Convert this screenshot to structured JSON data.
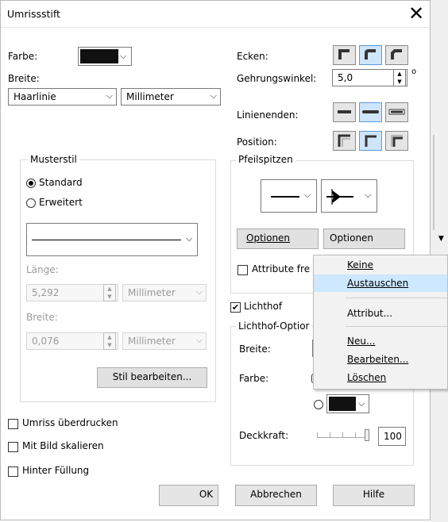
{
  "dialog": {
    "title": "Umrissstift",
    "close": "✕"
  },
  "left": {
    "farbe_label": "Farbe:",
    "breite_label": "Breite:",
    "breite_value": "Haarlinie",
    "unit_value": "Millimeter",
    "musterstil": {
      "title": "Musterstil",
      "standard": "Standard",
      "erweitert": "Erweitert",
      "laenge_label": "Länge:",
      "laenge_value": "5,292",
      "laenge_unit": "Millimeter",
      "breite_label": "Breite:",
      "breite_value": "0,076",
      "breite_unit": "Millimeter",
      "edit_button": "Stil bearbeiten..."
    },
    "umriss_ueberdrucken": "Umriss überdrucken",
    "mit_bild_skalieren": "Mit Bild skalieren",
    "hinter_fuellung": "Hinter Füllung"
  },
  "right": {
    "ecken_label": "Ecken:",
    "gehrung_label": "Gehrungswinkel:",
    "gehrung_value": "5,0",
    "degree": "o",
    "linienenden_label": "Linienenden:",
    "position_label": "Position:",
    "pfeilspitzen": {
      "title": "Pfeilspitzen",
      "optionen1": "Optionen",
      "optionen2": "Optionen",
      "attribute": "Attribute fre"
    },
    "lichthof": "Lichthof",
    "lichthof_optionen": {
      "title": "Lichthof-Optior",
      "breite_label": "Breite:",
      "farbe_label": "Farbe:",
      "deckkraft_label": "Deckkraft:",
      "deckkraft_value": "100"
    }
  },
  "menu": {
    "items": [
      "Keine",
      "Austauschen",
      "Attribut...",
      "Neu...",
      "Bearbeiten...",
      "Löschen"
    ]
  },
  "footer": {
    "ok": "OK",
    "cancel": "Abbrechen",
    "help": "Hilfe"
  }
}
